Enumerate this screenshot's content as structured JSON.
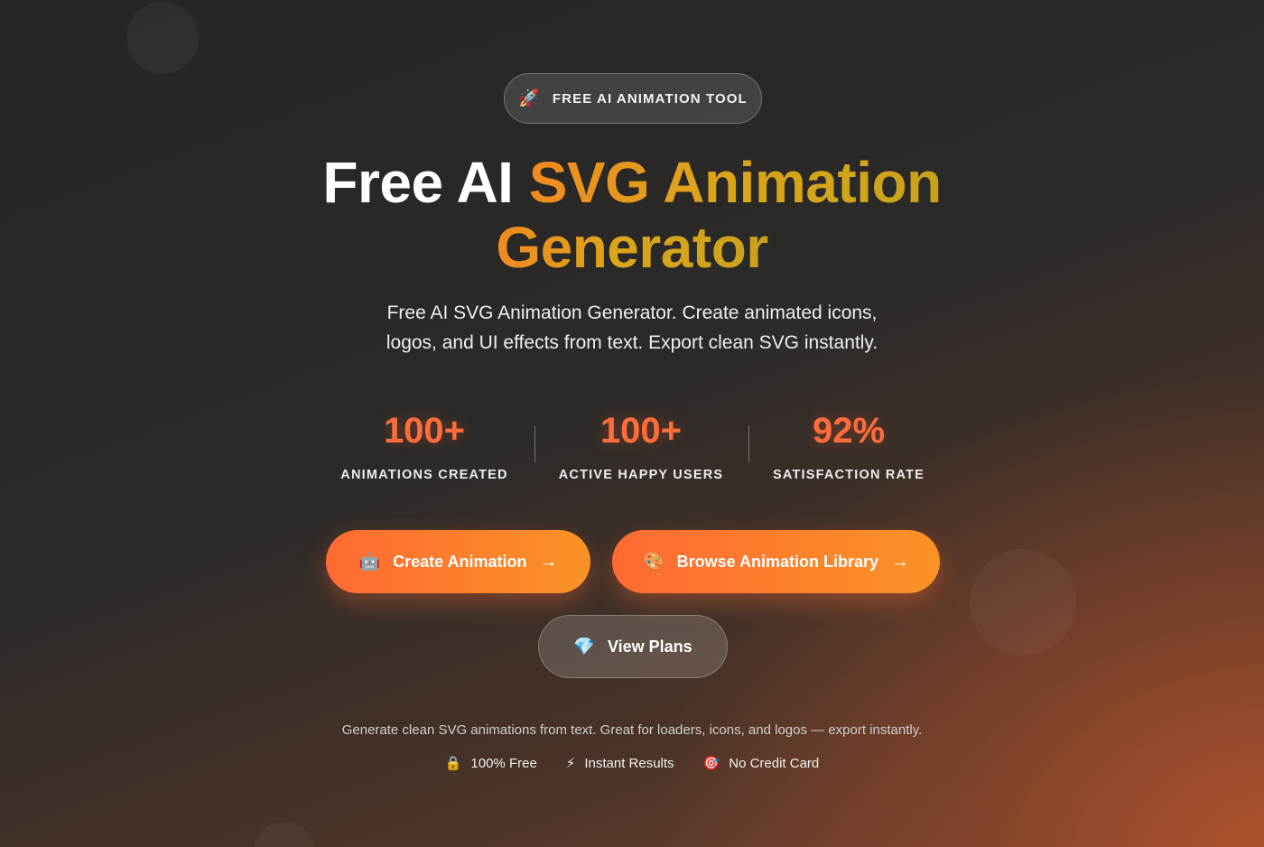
{
  "hero": {
    "badge": {
      "icon": "rocket-icon",
      "glyph": "🚀",
      "text": "FREE AI ANIMATION TOOL"
    },
    "title_plain": "Free AI ",
    "title_highlight_1": "SVG Animation",
    "title_highlight_2": "Generator",
    "subtitle_line1": "Free AI SVG Animation Generator. Create animated icons,",
    "subtitle_line2": "logos, and UI effects from text. Export clean SVG instantly."
  },
  "stats": [
    {
      "value": "100+",
      "label": "ANIMATIONS CREATED"
    },
    {
      "value": "100+",
      "label": "ACTIVE HAPPY USERS"
    },
    {
      "value": "92%",
      "label": "SATISFACTION RATE"
    }
  ],
  "buttons": {
    "create": {
      "icon": "robot-icon",
      "glyph": "🤖",
      "label": "Create Animation",
      "arrow": "→"
    },
    "browse": {
      "icon": "palette-icon",
      "glyph": "🎨",
      "label": "Browse Animation Library",
      "arrow": "→"
    },
    "plans": {
      "icon": "gem-icon",
      "glyph": "💎",
      "label": "View Plans"
    }
  },
  "footer": {
    "text": "Generate clean SVG animations from text. Great for loaders, icons, and logos — export instantly.",
    "features": [
      {
        "icon": "lock-icon",
        "glyph": "🔒",
        "label": "100% Free"
      },
      {
        "icon": "lightning-icon",
        "glyph": "⚡",
        "label": "Instant Results"
      },
      {
        "icon": "target-icon",
        "glyph": "🎯",
        "label": "No Credit Card"
      }
    ]
  },
  "colors": {
    "accent": "#ff6d3a",
    "gradient_start": "#ff6a33",
    "gradient_end": "#fa9326",
    "title_gold": "#dca51a"
  }
}
